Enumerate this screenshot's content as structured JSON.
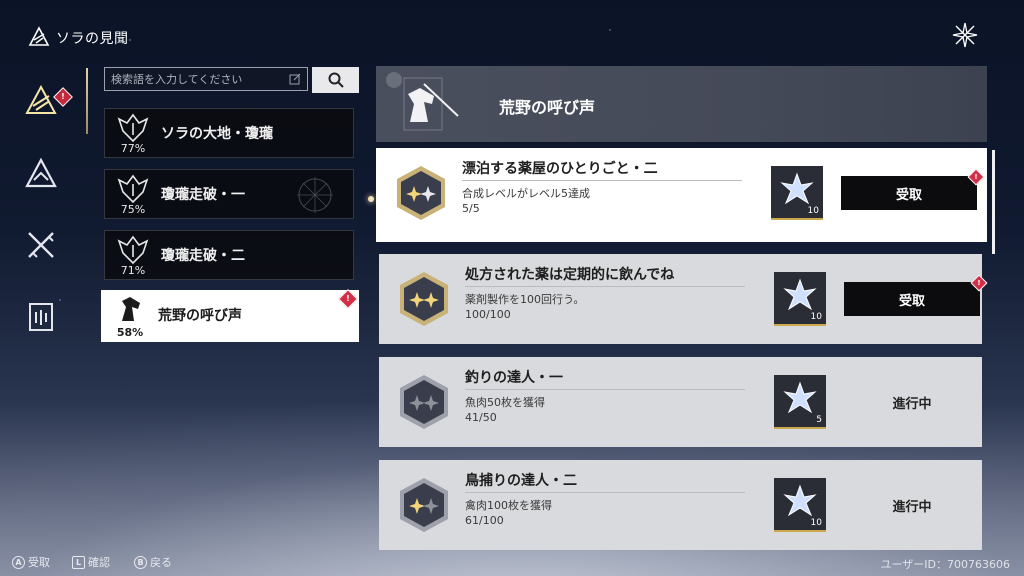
{
  "header": {
    "title": "ソラの見聞"
  },
  "nav": {
    "items": [
      {
        "icon": "achievement-icon",
        "badge": "!"
      },
      {
        "icon": "mountain-icon"
      },
      {
        "icon": "crossed-swords-icon"
      },
      {
        "icon": "book-icon"
      }
    ]
  },
  "search": {
    "placeholder": "検索語を入力してください"
  },
  "categories": [
    {
      "name": "ソラの大地・瓊瓏",
      "percent": "77%"
    },
    {
      "name": "瓊瓏走破・一",
      "percent": "75%"
    },
    {
      "name": "瓊瓏走破・二",
      "percent": "71%"
    },
    {
      "name": "荒野の呼び声",
      "percent": "58%",
      "badge": "!"
    }
  ],
  "panel": {
    "title": "荒野の呼び声",
    "achievements": [
      {
        "title": "漂泊する薬屋のひとりごと・二",
        "desc": "合成レベルがレベル5達成",
        "progress": "5/5",
        "reward_count": "10",
        "action": "受取",
        "badge": "!"
      },
      {
        "title": "処方された薬は定期的に飲んでね",
        "desc": "薬剤製作を100回行う。",
        "progress": "100/100",
        "reward_count": "10",
        "action": "受取",
        "badge": "!"
      },
      {
        "title": "釣りの達人・一",
        "desc": "魚肉50枚を獲得",
        "progress": "41/50",
        "reward_count": "5",
        "status": "進行中"
      },
      {
        "title": "鳥捕りの達人・二",
        "desc": "禽肉100枚を獲得",
        "progress": "61/100",
        "reward_count": "10",
        "status": "進行中"
      }
    ]
  },
  "footer": {
    "a_key": "A",
    "a_label": "受取",
    "l_key": "L",
    "l_label": "確認",
    "b_key": "B",
    "b_label": "戻る",
    "user_id": "ユーザーID：700763606"
  },
  "colors": {
    "accent_gold": "#c9a94c",
    "badge_red": "#d23048"
  }
}
